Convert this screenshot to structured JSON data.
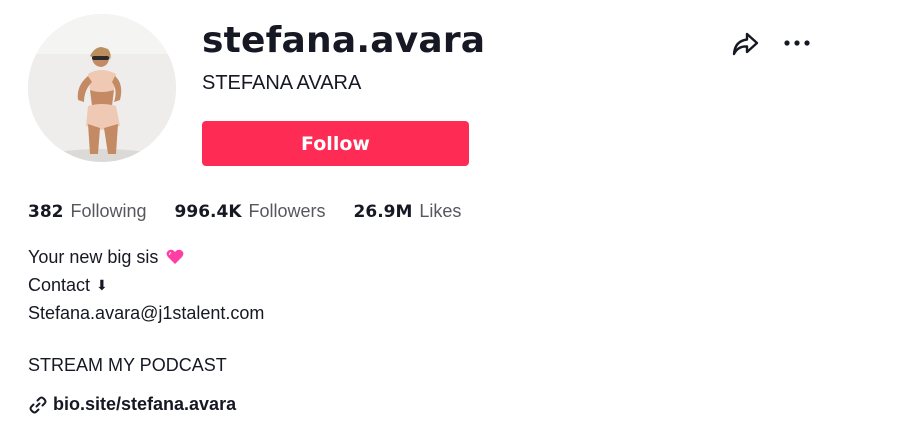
{
  "profile": {
    "username": "stefana.avara",
    "nickname": "STEFANA AVARA",
    "follow_label": "Follow"
  },
  "stats": {
    "following_count": "382",
    "following_label": "Following",
    "followers_count": "996.4K",
    "followers_label": "Followers",
    "likes_count": "26.9M",
    "likes_label": "Likes"
  },
  "bio": {
    "line1": "Your new big sis",
    "line2": "Contact",
    "line2_arrow": "⬇",
    "line3": "Stefana.avara@j1stalent.com",
    "line5": "STREAM MY PODCAST"
  },
  "link": {
    "text": "bio.site/stefana.avara"
  },
  "icons": {
    "share": "share-icon",
    "more": "more-icon",
    "heart": "pink-heart-icon",
    "link": "link-icon"
  },
  "colors": {
    "accent": "#fe2c55",
    "heart": "#ff3fa4",
    "text": "#161823",
    "muted": "#57585f"
  }
}
